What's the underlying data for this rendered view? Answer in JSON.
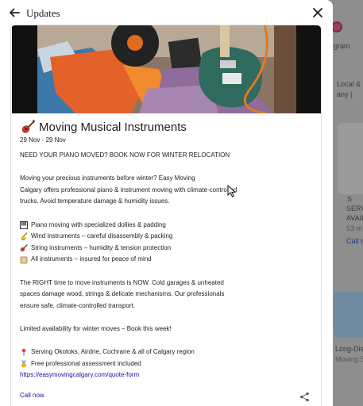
{
  "background": {
    "texts": [
      "gram",
      "Local &",
      "any |",
      "S",
      "SERV",
      "AVAIL",
      "53 m",
      "Call n",
      "Long-Dista",
      "Moving Se"
    ]
  },
  "dialog": {
    "title": "Updates",
    "back_icon": "arrow-left-icon",
    "close_icon": "close-icon",
    "post": {
      "image_description_icon": "post-photo",
      "title": "Moving Musical Instruments",
      "title_icon": "guitar-icon",
      "date_range": "29 Nov - 29 Nov",
      "headline": "NEED YOUR PIANO MOVED? BOOK NOW FOR WINTER RELOCATION",
      "intro": [
        "Moving your precious instruments before winter? Easy Moving",
        "Calgary offers professional piano & instrument moving with climate-controlled",
        "trucks. Avoid temperature damage & humidity issues."
      ],
      "features": [
        {
          "icon": "piano-icon",
          "text": "Piano moving with specialized dollies & padding"
        },
        {
          "icon": "saxophone-icon",
          "text": "Wind instruments – careful disassembly & packing"
        },
        {
          "icon": "guitar-icon",
          "text": "String instruments – humidity & tension protection"
        },
        {
          "icon": "scroll-icon",
          "text": "All instruments – insured for peace of mind"
        }
      ],
      "paragraph": [
        "The RIGHT time to move instruments is NOW. Cold garages & unheated",
        "spaces damage wood, strings & delicate mechanisms. Our professionals",
        "ensure safe, climate-controlled transport."
      ],
      "limited": "Limited availability for winter moves – Book this week!",
      "service_area": {
        "icon": "pin-icon",
        "text": "Serving Okotoks, Airdrie, Cochrane & all of Calgary region"
      },
      "assessment": {
        "icon": "medal-icon",
        "text": "Free professional assessment included"
      },
      "url": "https://easymovingcalgary.com/quote-form",
      "call_label": "Call now",
      "share_icon": "share-icon"
    }
  },
  "colors": {
    "link": "#1a0dab",
    "text": "#202124",
    "overlay": "#7d7d7d"
  }
}
